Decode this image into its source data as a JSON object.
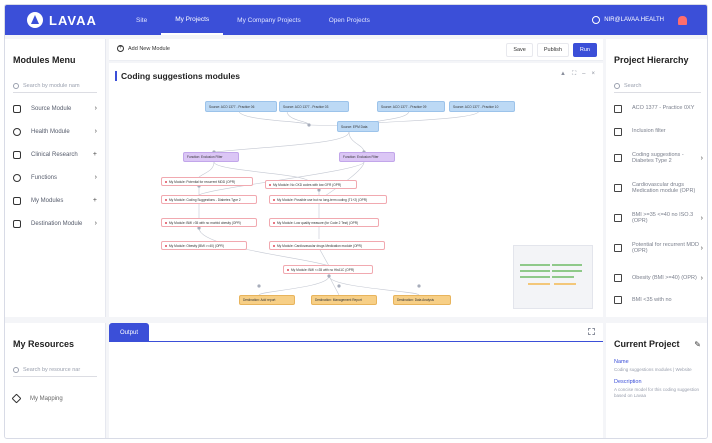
{
  "app": {
    "logo_text": "LAVAA",
    "brand_color": "#3b4fd8"
  },
  "nav": {
    "items": [
      "Site",
      "My Projects",
      "My Company Projects",
      "Open Projects"
    ],
    "active": "My Projects",
    "user": "NIR@LAVAA.HEALTH"
  },
  "modules_menu": {
    "title": "Modules Menu",
    "search_placeholder": "Search by module nam",
    "items": [
      {
        "label": "Source Module",
        "icon": "database-icon",
        "arrow": "›"
      },
      {
        "label": "Health Module",
        "icon": "heart-icon",
        "arrow": "›"
      },
      {
        "label": "Clinical Research",
        "icon": "microscope-icon",
        "arrow": "+"
      },
      {
        "label": "Functions",
        "icon": "function-icon",
        "arrow": "›"
      },
      {
        "label": "My Modules",
        "icon": "grid-icon",
        "arrow": "+"
      },
      {
        "label": "Destination Module",
        "icon": "export-icon",
        "arrow": "›"
      }
    ]
  },
  "resources": {
    "title": "My Resources",
    "search_placeholder": "Search by resource nar",
    "items": [
      {
        "label": "My Mapping"
      }
    ]
  },
  "toolbar": {
    "add_module": "Add New Module",
    "save": "Save",
    "publish": "Publish",
    "run": "Run"
  },
  "canvas": {
    "title": "Coding suggestions modules",
    "ctrl_up": "▲",
    "ctrl_fit": "⛶",
    "ctrl_min": "–",
    "ctrl_close": "×",
    "nodes": {
      "s1": "Source: ACO 1377 - Practice 06",
      "s2": "Source: ACO 1377 - Practice 03",
      "s3": "Source: ACO 1377 - Practice 09",
      "s4": "Source: ACO 1377 - Practice 10",
      "s5": "Source: EPM Data",
      "f1": "Function: Exclusion Filter",
      "f2": "Function: Exclusion Filter",
      "m1": "My Module: Potential for recurrent MDD (OPR)",
      "m2": "My Module: No CKD codes with low GFR (OPR)",
      "m3": "My Module: Coding Suggestions - Diabetes Type 2",
      "m4": "My Module: Possible use but no long-term coding (T1+2) (OPR)",
      "m5": "My Module: BMI >35 with no morbid obesity (OPR)",
      "m6": "My Module: Low quality measure (for Code 2 Test) (OPR)",
      "m7": "My Module: Obesity (BMI >=40) (OPR)",
      "m8": "My Module: Cardiovascular drugs Medication module (OPR)",
      "m9": "My Module: BMI <=35 with no HbA1C (OPR)",
      "o1": "Destination: Add report",
      "o2": "Destination: Management Report",
      "o3": "Destination: Data Analysis"
    }
  },
  "output": {
    "tab": "Output"
  },
  "hierarchy": {
    "title": "Project Hierarchy",
    "search_placeholder": "Search",
    "items": [
      {
        "label": "ACO 1377 - Practice 0XY",
        "arrow": ""
      },
      {
        "label": "Inclusion filter",
        "arrow": ""
      },
      {
        "label": "Coding suggestions - Diabetes Type 2",
        "arrow": "›"
      },
      {
        "label": "Cardiovascular drugs Medication module (OPR)",
        "arrow": ""
      },
      {
        "label": "BMI >=35 <=40 no ISO.3 (OPR)",
        "arrow": "›"
      },
      {
        "label": "Potential for recurrent MDD (OPR)",
        "arrow": "›"
      },
      {
        "label": "Obesity (BMI >=40) (OPR)",
        "arrow": "›"
      },
      {
        "label": "BMI <35 with no",
        "arrow": ""
      }
    ]
  },
  "current_project": {
    "title": "Current Project",
    "name_label": "Name",
    "name_value": "Coding suggestions modules | Website",
    "desc_label": "Description",
    "desc_value": "A concise model for this coding suggestion based on Lavaa"
  }
}
